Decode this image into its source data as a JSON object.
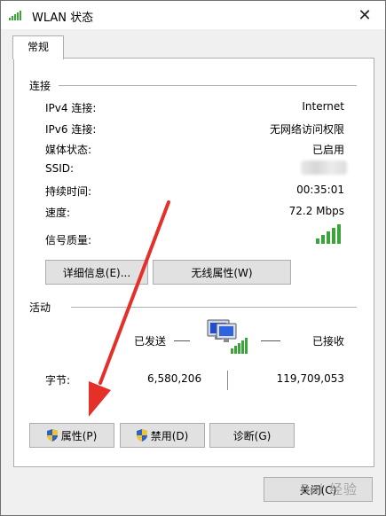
{
  "window": {
    "title": "WLAN 状态",
    "close_glyph": "✕"
  },
  "tabs": [
    {
      "label": "常规"
    }
  ],
  "connection": {
    "title": "连接",
    "rows": [
      {
        "label": "IPv4 连接:",
        "value": "Internet"
      },
      {
        "label": "IPv6 连接:",
        "value": "无网络访问权限"
      },
      {
        "label": "媒体状态:",
        "value": "已启用"
      },
      {
        "label": "SSID:",
        "value": ""
      },
      {
        "label": "持续时间:",
        "value": "00:35:01"
      },
      {
        "label": "速度:",
        "value": "72.2 Mbps"
      },
      {
        "label": "信号质量:",
        "value": ""
      }
    ],
    "signal_bars_filled": 5,
    "signal_bars_total": 5,
    "buttons": {
      "details": "详细信息(E)...",
      "wireless_props": "无线属性(W)"
    }
  },
  "activity": {
    "title": "活动",
    "sent_label": "已发送",
    "received_label": "已接收",
    "bytes_label": "字节:",
    "bytes_sent": "6,580,206",
    "bytes_received": "119,709,053"
  },
  "action_buttons": {
    "properties": "属性(P)",
    "disable": "禁用(D)",
    "diagnose": "诊断(G)"
  },
  "footer": {
    "close_label": "关闭(C)"
  },
  "watermark": "Bai 经验",
  "colors": {
    "signal_green": "#3aa63a",
    "arrow_red": "#e5302a",
    "shield_blue": "#2a63c7",
    "shield_yellow": "#f2c230"
  }
}
